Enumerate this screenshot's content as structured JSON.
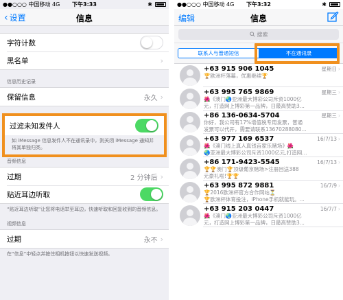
{
  "left": {
    "status": {
      "carrier": "●●○○○ 中国移动  4G",
      "time": "下午3:33"
    },
    "nav": {
      "back": "设置",
      "title": "信息"
    },
    "rows_top": [
      {
        "label": "字符计数",
        "toggle": "off"
      },
      {
        "label": "黑名单",
        "arrow": "›"
      }
    ],
    "history_header": "信息历史记录",
    "keep": {
      "label": "保留信息",
      "value": "永久",
      "arrow": "›"
    },
    "filter": {
      "label": "过滤未知发件人",
      "note": "如 iMessage 信息发件人不在通讯录中，则关闭 iMessage 通知并将其单独归类。"
    },
    "audio_header": "音频信息",
    "audio_expire": {
      "label": "过期",
      "value": "2 分钟后",
      "arrow": "›"
    },
    "raise": {
      "label": "贴近耳边听取"
    },
    "raise_note": "“贴近耳边听取”让您将电话举至耳边，快速听取和回复收到的音频信息。",
    "video_header": "视频信息",
    "video_expire": {
      "label": "过期",
      "value": "永不",
      "arrow": "›"
    },
    "video_note": "在“信息”中轻点并按住相机按钮以快速发送视频。"
  },
  "right": {
    "status": {
      "carrier": "●●○○○ 中国移动  4G",
      "time": "下午3:32"
    },
    "nav": {
      "edit": "编辑",
      "title": "信息"
    },
    "search_placeholder": "搜索",
    "segments": [
      "联系人与普通短信",
      "不在通讯录"
    ],
    "messages": [
      {
        "number": "+63 915 906 1045",
        "date": "星期日",
        "line1": "🏆欧洲杯落幕，优惠继续🏆",
        "line2": ""
      },
      {
        "number": "+63 995 765 9869",
        "date": "星期三",
        "line1": "🌺《澳门🌏亚洲最大博彩公司斥资1000亿",
        "line2": "元，打造网上博彩第一品牌，日最高赞助3..."
      },
      {
        "number": "+86 136-0634-5704",
        "date": "星期三",
        "line1": "你好，我公司有17%增值税专用发票，普通",
        "line2": "发票可以代开，需要请联系13670288080..."
      },
      {
        "number": "+63 977 169 6537",
        "date": "16/7/13",
        "line1": "🌺《澳门线上真人真钱百家乐赌场》🌺",
        "line2": "🌏亚洲最大博彩公司斥资1000亿元,打造网..."
      },
      {
        "number": "+86 171-9423-5545",
        "date": "16/7/13",
        "line1": "🏆🏆澳门🏆顶级葡京赌场>注册回送388",
        "line2": "元豪礼啦!🏆🏆"
      },
      {
        "number": "+63 995 872 9881",
        "date": "16/7/9",
        "line1": "🏆2016欧洲杯官方合作网站⏳",
        "line2": "🏆欧洲杯体育投注，iPhone手机就能玩。..."
      },
      {
        "number": "+63 915 203 0447",
        "date": "16/7/7",
        "line1": "🌺《澳门🌏亚洲最大博彩公司斥资1000亿",
        "line2": "元，打造网上博彩第一品牌，日最高赞助3..."
      }
    ]
  },
  "colors": {
    "accent": "#007aff",
    "highlight": "#f0901e",
    "toggle_on": "#4cd964"
  }
}
